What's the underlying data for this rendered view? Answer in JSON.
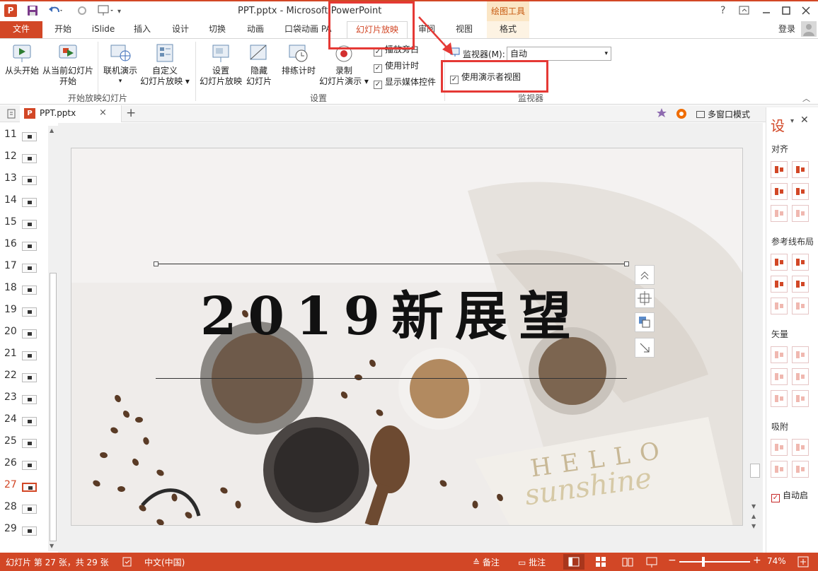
{
  "title_bar": {
    "title": "PPT.pptx - Microsoft PowerPoint",
    "drawing_tools": "绘图工具",
    "help": "?",
    "controls": [
      "minimize-restore-ribbon",
      "minimize",
      "maximize",
      "close"
    ]
  },
  "tabs": {
    "file": "文件",
    "items": [
      "开始",
      "iSlide",
      "插入",
      "设计",
      "切换",
      "动画",
      "口袋动画 PA",
      "幻灯片放映",
      "审阅",
      "视图",
      "格式"
    ],
    "active": "幻灯片放映",
    "login": "登录"
  },
  "ribbon": {
    "start_group": {
      "label": "开始放映幻灯片",
      "from_beginning": "从头开始",
      "from_current_1": "从当前幻灯片",
      "from_current_2": "开始",
      "online": "联机演示",
      "custom_1": "自定义",
      "custom_2": "幻灯片放映"
    },
    "setup_group": {
      "label": "设置",
      "setup_1": "设置",
      "setup_2": "幻灯片放映",
      "hide_1": "隐藏",
      "hide_2": "幻灯片",
      "rehearse": "排练计时",
      "record_1": "录制",
      "record_2": "幻灯片演示",
      "cb_narration": "播放旁白",
      "cb_timing": "使用计时",
      "cb_media": "显示媒体控件"
    },
    "monitor_group": {
      "label": "监视器",
      "monitor_label": "监视器(M):",
      "monitor_value": "自动",
      "presenter_view": "使用演示者视图"
    }
  },
  "doc_tab": {
    "name": "PPT.pptx",
    "multiwindow": "多窗口模式"
  },
  "thumbnails": [
    {
      "n": "11"
    },
    {
      "n": "12"
    },
    {
      "n": "13"
    },
    {
      "n": "14"
    },
    {
      "n": "15"
    },
    {
      "n": "16"
    },
    {
      "n": "17"
    },
    {
      "n": "18"
    },
    {
      "n": "19"
    },
    {
      "n": "20"
    },
    {
      "n": "21"
    },
    {
      "n": "22"
    },
    {
      "n": "23"
    },
    {
      "n": "24"
    },
    {
      "n": "25"
    },
    {
      "n": "26"
    },
    {
      "n": "27"
    },
    {
      "n": "28"
    },
    {
      "n": "29"
    }
  ],
  "slide": {
    "title": "2019新展望",
    "bag_line1": "HELLO",
    "bag_line2": "sunshine"
  },
  "right_panel": {
    "title": "设",
    "align": "对齐",
    "guides": "参考线布局",
    "vector": "矢量",
    "snap": "吸附",
    "auto": "自动启"
  },
  "status_bar": {
    "slide_info": "幻灯片 第 27 张，共 29 张",
    "language": "中文(中国)",
    "notes": "备注",
    "comments": "批注",
    "zoom": "74%"
  },
  "colors": {
    "accent": "#d24726",
    "highlight": "#e53935"
  }
}
